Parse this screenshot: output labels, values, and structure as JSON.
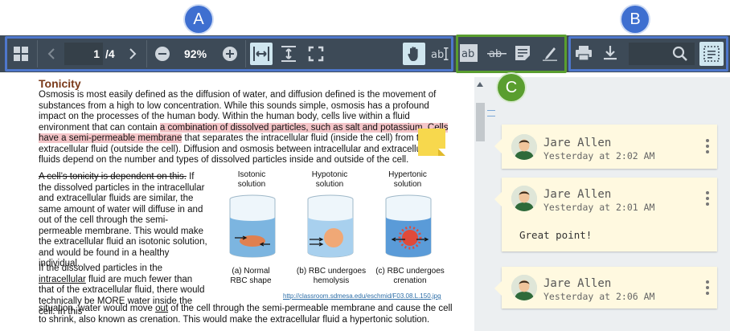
{
  "badges": {
    "a": "A",
    "b": "B",
    "c": "C"
  },
  "toolbar": {
    "page_current": "1",
    "page_total": "/4",
    "zoom": "92%"
  },
  "document": {
    "title": "Tonicity",
    "p1_a": "Osmosis is most easily defined as the diffusion of water, and diffusion defined is the movement of substances from a high to low concentration.  While this sounds simple, osmosis has a profound impact on the processes of the human body.  Within the human body, cells live within a fluid environment that can contain ",
    "p1_hl1": "a combination of dissolved particles, such as salt and potassium.  Cells have a semi-permeable membrane",
    "p1_b": " that separates the intracellular fluid (inside the cell) from the extracellular fluid (outside the cell).  Diffusion and osmosis between intracellular and extracellular fluids depend on the number and types of dissolved particles inside and outside of the cell.",
    "p2_strike": "A cell’s tonicity is dependent on this.",
    "p2_rest": "  If the dissolved particles in the intracellular and extracellular fluids are similar, the same amount of water will diffuse in and out of the cell through the semi-permeable membrane. This would make the extracellular fluid an isotonic solution, and would be found in a healthy individual.",
    "p3_a": "If the dissolved particles in the ",
    "p3_u": "intracellular",
    "p3_b": " fluid are much fewer than that of the extracellular fluid, there would technically be MORE water inside the cell.  In this",
    "p4_a": "situation, water would move ",
    "p4_u": "out",
    "p4_b": " of the cell through the semi-permeable membrane and cause the cell to shrink, also known as crenation.  This would make the extracellular fluid a hypertonic solution.",
    "figure": {
      "col1_title": "Isotonic\nsolution",
      "col2_title": "Hypotonic\nsolution",
      "col3_title": "Hypertonic\nsolution",
      "cap1": "(a) Normal\nRBC shape",
      "cap2": "(b) RBC undergoes\nhemolysis",
      "cap3": "(c) RBC undergoes\ncrenation",
      "link": "http://classroom.sdmesa.edu/eschmid/F03.08.L.150.jpg"
    }
  },
  "comments": [
    {
      "name": "Jare Allen",
      "time": "Yesterday at 2:02 AM",
      "body": ""
    },
    {
      "name": "Jare Allen",
      "time": "Yesterday at 2:01 AM",
      "body": "Great point!"
    },
    {
      "name": "Jare Allen",
      "time": "Yesterday at 2:06 AM",
      "body": ""
    }
  ],
  "colors": {
    "toolbar_bg": "#3d4a57",
    "badge_blue": "#3e6fd0",
    "badge_green": "#5a9e2f",
    "highlight": "#f4c5c8",
    "card_bg": "#fff9e0"
  },
  "icons": [
    "grid-icon",
    "chevron-left-icon",
    "chevron-right-icon",
    "zoom-out-icon",
    "zoom-in-icon",
    "fit-width-icon",
    "fit-height-icon",
    "fullscreen-icon",
    "hand-tool-icon",
    "text-select-icon",
    "highlight-text-icon",
    "strikethrough-icon",
    "note-icon",
    "draw-icon",
    "print-icon",
    "download-icon",
    "search-icon",
    "comments-panel-icon"
  ]
}
